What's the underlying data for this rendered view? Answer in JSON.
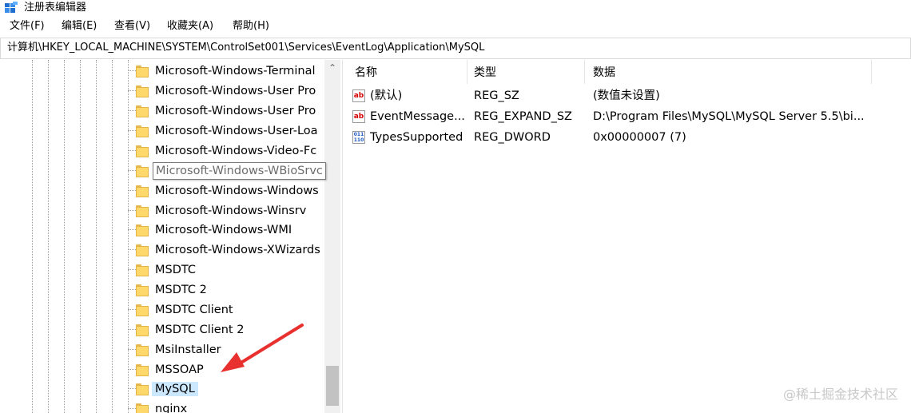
{
  "window": {
    "title": "注册表编辑器",
    "icon": "regedit-icon"
  },
  "menu": [
    "文件(F)",
    "编辑(E)",
    "查看(V)",
    "收藏夹(A)",
    "帮助(H)"
  ],
  "address": "计算机\\HKEY_LOCAL_MACHINE\\SYSTEM\\ControlSet001\\Services\\EventLog\\Application\\MySQL",
  "tree": {
    "items": [
      "Microsoft-Windows-Terminal",
      "Microsoft-Windows-User Pro",
      "Microsoft-Windows-User Pro",
      "Microsoft-Windows-User-Loa",
      "Microsoft-Windows-Video-Fc",
      "Microsoft-Windows-WBioSrvc",
      "Microsoft-Windows-Windows",
      "Microsoft-Windows-Winsrv",
      "Microsoft-Windows-WMI",
      "Microsoft-Windows-XWizards",
      "MSDTC",
      "MSDTC 2",
      "MSDTC Client",
      "MSDTC Client 2",
      "MsiInstaller",
      "MSSOAP",
      "MySQL",
      "nginx"
    ],
    "tooltip_item": "Microsoft-Windows-WBioSrvc",
    "selected_item": "MySQL",
    "arrow_color": "#e8312f"
  },
  "values": {
    "columns": [
      "名称",
      "类型",
      "数据"
    ],
    "rows": [
      {
        "icon": "ab",
        "name": "(默认)",
        "type": "REG_SZ",
        "data": "(数值未设置)"
      },
      {
        "icon": "ab",
        "name": "EventMessage...",
        "type": "REG_EXPAND_SZ",
        "data": "D:\\Program Files\\MySQL\\MySQL Server 5.5\\bi..."
      },
      {
        "icon": "bin",
        "name": "TypesSupported",
        "type": "REG_DWORD",
        "data": "0x00000007 (7)"
      }
    ]
  },
  "watermark": "@稀土掘金技术社区"
}
